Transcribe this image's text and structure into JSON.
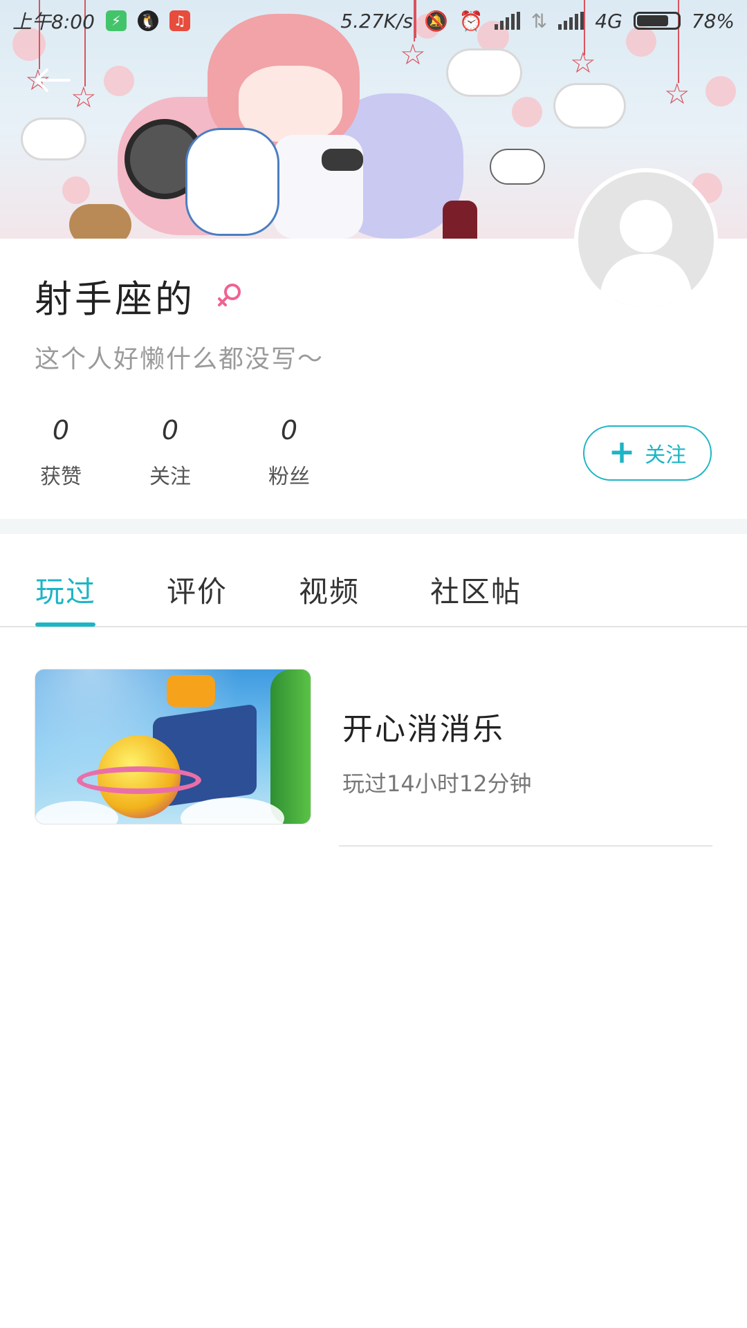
{
  "status_bar": {
    "time": "上午8:00",
    "net_speed": "5.27K/s",
    "network_type": "4G",
    "battery": "78%",
    "battery_level": 0.78
  },
  "profile": {
    "name": "射手座的",
    "gender": "female",
    "bio": "这个人好懒什么都没写～",
    "stats": [
      {
        "value": "0",
        "label": "获赞"
      },
      {
        "value": "0",
        "label": "关注"
      },
      {
        "value": "0",
        "label": "粉丝"
      }
    ],
    "follow_button": "关注"
  },
  "tabs": [
    {
      "label": "玩过",
      "active": true
    },
    {
      "label": "评价",
      "active": false
    },
    {
      "label": "视频",
      "active": false
    },
    {
      "label": "社区帖",
      "active": false
    }
  ],
  "games": [
    {
      "title": "开心消消乐",
      "playtime": "玩过14小时12分钟"
    }
  ],
  "colors": {
    "accent": "#1cb5c5",
    "gender_female": "#f06292"
  }
}
